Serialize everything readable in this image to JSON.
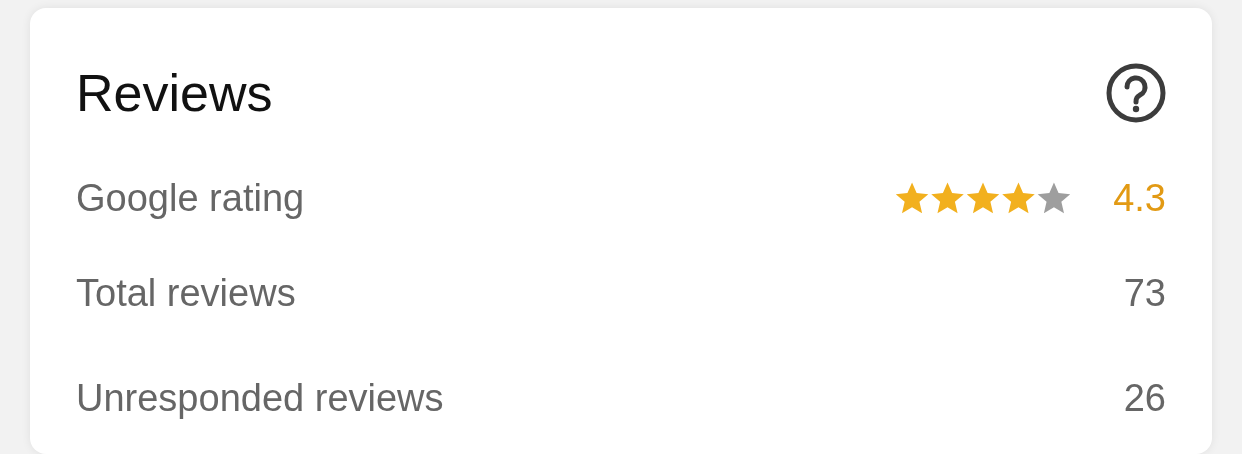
{
  "card": {
    "title": "Reviews"
  },
  "rows": [
    {
      "kind": "rating",
      "label": "Google rating",
      "stars": 4,
      "value": "4.3"
    },
    {
      "kind": "plain",
      "label": "Total reviews",
      "value": "73"
    },
    {
      "kind": "plain",
      "label": "Unresponded reviews",
      "value": "26"
    }
  ]
}
